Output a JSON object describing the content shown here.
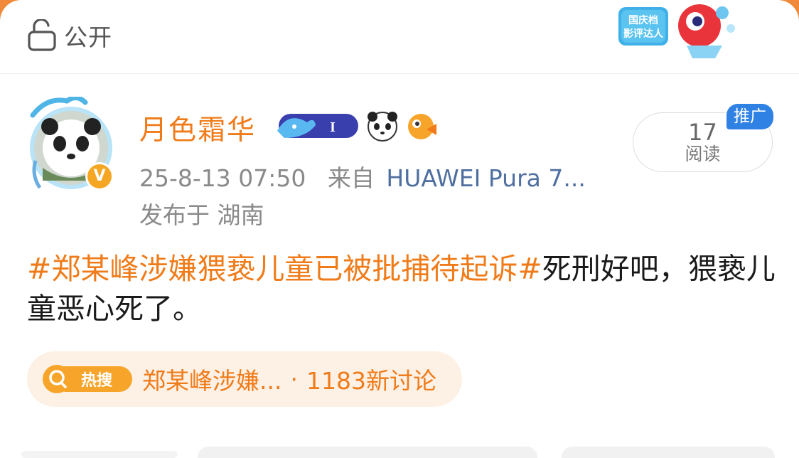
{
  "visibility": {
    "icon": "lock-open-icon",
    "label": "公开"
  },
  "event_badge": {
    "text_line1": "国庆档",
    "text_line2": "影评达人"
  },
  "user": {
    "name": "月色霜华",
    "avatar": "panda-avatar",
    "verified_badge": "V",
    "vip_level": "I"
  },
  "meta": {
    "datetime": "25-8-13 07:50",
    "source_prefix": "来自",
    "source": "HUAWEI Pura 7..."
  },
  "location": "发布于 湖南",
  "reads": {
    "count": "17",
    "label": "阅读"
  },
  "promo_tag": "推广",
  "post": {
    "topic": "#郑某峰涉嫌猥亵儿童已被批捕待起诉#",
    "text": "死刑好吧，猥亵儿童恶心死了。"
  },
  "hot_search": {
    "icon_label": "热搜",
    "title": "郑某峰涉嫌...",
    "separator": "·",
    "count_text": "1183新讨论"
  },
  "colors": {
    "accent": "#f07b19",
    "link": "#4f6fa0",
    "promo": "#2f82e4",
    "top_strip": "#f08a3a"
  }
}
